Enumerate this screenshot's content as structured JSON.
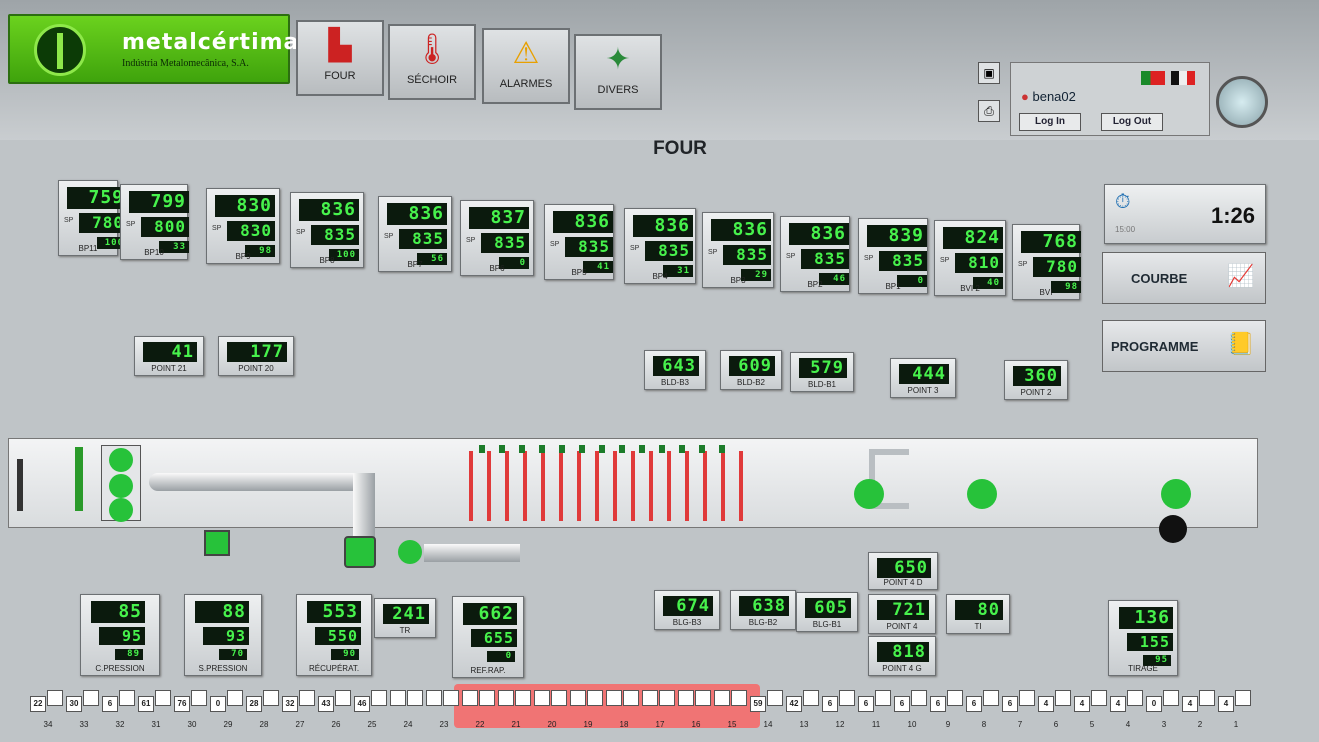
{
  "app": {
    "brand": "metalcértima",
    "subtitle": "Indústria Metalomecânica, S.A.",
    "page_title": "FOUR"
  },
  "nav": [
    {
      "label": "FOUR",
      "icon": "furnace-icon"
    },
    {
      "label": "SÉCHOIR",
      "icon": "thermometer-icon"
    },
    {
      "label": "ALARMES",
      "icon": "warning-icon"
    },
    {
      "label": "DIVERS",
      "icon": "tools-icon"
    }
  ],
  "user": {
    "name": "bena02",
    "login": "Log In",
    "logout": "Log Out"
  },
  "timer": {
    "value": "1:26",
    "sub": "15:00"
  },
  "side": {
    "courbe": "COURBE",
    "programme": "PROGRAMME"
  },
  "zones": [
    {
      "name": "BP11",
      "pv": "759",
      "sp": "780",
      "pct": "100"
    },
    {
      "name": "BP10",
      "pv": "799",
      "sp": "800",
      "pct": "33"
    },
    {
      "name": "BP9",
      "pv": "830",
      "sp": "830",
      "pct": "98"
    },
    {
      "name": "BP8",
      "pv": "836",
      "sp": "835",
      "pct": "100"
    },
    {
      "name": "BP7",
      "pv": "836",
      "sp": "835",
      "pct": "56"
    },
    {
      "name": "BP6",
      "pv": "837",
      "sp": "835",
      "pct": "0"
    },
    {
      "name": "BP5",
      "pv": "836",
      "sp": "835",
      "pct": "41"
    },
    {
      "name": "BP4",
      "pv": "836",
      "sp": "835",
      "pct": "31"
    },
    {
      "name": "BP3",
      "pv": "836",
      "sp": "835",
      "pct": "29"
    },
    {
      "name": "BP2",
      "pv": "836",
      "sp": "835",
      "pct": "46"
    },
    {
      "name": "BP1",
      "pv": "839",
      "sp": "835",
      "pct": "0"
    },
    {
      "name": "BVI 2",
      "pv": "824",
      "sp": "810",
      "pct": "40"
    },
    {
      "name": "BVI",
      "pv": "768",
      "sp": "780",
      "pct": "98"
    }
  ],
  "points": [
    {
      "name": "POINT 21",
      "pv": "41"
    },
    {
      "name": "POINT 20",
      "pv": "177"
    },
    {
      "name": "BLD-B3",
      "pv": "643"
    },
    {
      "name": "BLD-B2",
      "pv": "609"
    },
    {
      "name": "BLD-B1",
      "pv": "579"
    },
    {
      "name": "POINT 3",
      "pv": "444"
    },
    {
      "name": "POINT 2",
      "pv": "360"
    },
    {
      "name": "POINT 4 D",
      "pv": "650"
    },
    {
      "name": "TR",
      "pv": "241"
    },
    {
      "name": "BLG-B3",
      "pv": "674"
    },
    {
      "name": "BLG-B2",
      "pv": "638"
    },
    {
      "name": "BLG-B1",
      "pv": "605"
    },
    {
      "name": "POINT 4",
      "pv": "721"
    },
    {
      "name": "TI",
      "pv": "80"
    },
    {
      "name": "POINT 4 G",
      "pv": "818"
    }
  ],
  "controllers": [
    {
      "name": "C.PRESSION",
      "pv": "85",
      "sp": "95",
      "pct": "89"
    },
    {
      "name": "S.PRESSION",
      "pv": "88",
      "sp": "93",
      "pct": "70"
    },
    {
      "name": "RÉCUPÉRAT.",
      "pv": "553",
      "sp": "550",
      "pct": "90"
    },
    {
      "name": "REF.RAP.",
      "pv": "662",
      "sp": "655",
      "pct": "0"
    },
    {
      "name": "TIRAGE",
      "pv": "136",
      "sp": "155",
      "pct": "95"
    }
  ],
  "carts": {
    "numbers": [
      "34",
      "33",
      "32",
      "31",
      "30",
      "29",
      "28",
      "27",
      "26",
      "25",
      "24",
      "23",
      "22",
      "21",
      "20",
      "19",
      "18",
      "17",
      "16",
      "15",
      "14",
      "13",
      "12",
      "11",
      "10",
      "9",
      "8",
      "7",
      "6",
      "5",
      "4",
      "3",
      "2",
      "1"
    ],
    "counts": [
      "22",
      "30",
      "6",
      "61",
      "76",
      "0",
      "28",
      "32",
      "43",
      "46",
      "",
      "",
      "",
      "",
      "",
      "",
      "",
      "",
      "",
      "",
      "59",
      "42",
      "6",
      "6",
      "6",
      "6",
      "6",
      "6",
      "4",
      "4",
      "4",
      "0",
      "4",
      "4"
    ]
  },
  "colors": {
    "lcd_green": "#47f24c",
    "logo_green": "#4fb915",
    "highlight_red": "#f07474"
  }
}
